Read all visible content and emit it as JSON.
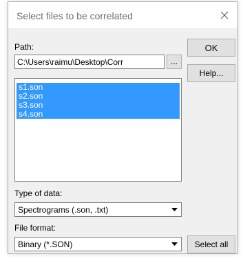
{
  "window": {
    "title": "Select files to be correlated"
  },
  "path": {
    "label": "Path:",
    "value": "C:\\Users\\raimu\\Desktop\\Corr",
    "browse_label": "..."
  },
  "buttons": {
    "ok": "OK",
    "help": "Help...",
    "select_all": "Select all"
  },
  "file_list": {
    "items": [
      "s1.son",
      "s2.son",
      "s3.son",
      "s4.son"
    ],
    "selected": [
      true,
      true,
      true,
      true
    ]
  },
  "type_of_data": {
    "label": "Type of data:",
    "value": "Spectrograms (.son, .txt)"
  },
  "file_format": {
    "label": "File format:",
    "value": "Binary (*.SON)"
  },
  "colors": {
    "selection": "#3399ff",
    "dialog_bg": "#f0f0f0"
  },
  "icons": {
    "close": "close-icon",
    "dropdown": "chevron-down-icon"
  }
}
